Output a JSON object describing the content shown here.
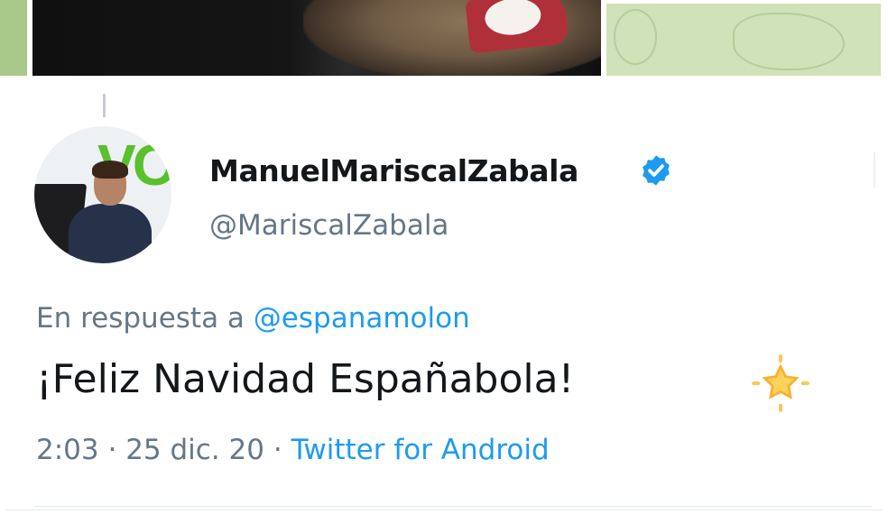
{
  "tweet": {
    "display_name": "ManuelMariscalZabala",
    "handle": "@MariscalZabala",
    "reply_prefix": "En respuesta a",
    "reply_to": "@espanamolon",
    "text": "¡Feliz Navidad Españabola!",
    "emoji_icon": "star-icon",
    "time": "2:03",
    "separator": "·",
    "date": "25 dic. 20",
    "source": "Twitter for Android"
  },
  "colors": {
    "link": "#1d9bf0",
    "secondary_text": "#657786",
    "primary_text": "#14171a",
    "verified": "#1d9bf0"
  },
  "icons": {
    "verified": "verified-badge-icon",
    "star": "star-icon"
  }
}
